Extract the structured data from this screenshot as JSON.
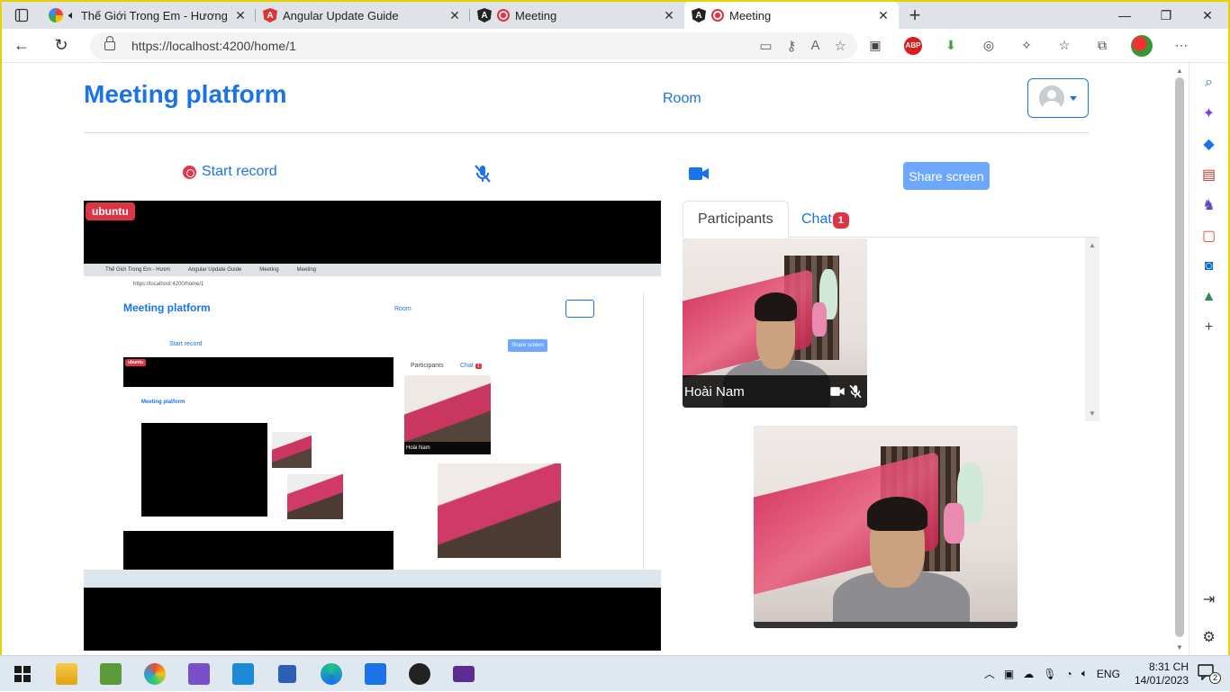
{
  "browser": {
    "tabs": [
      {
        "title": "Thế Giới Trong Em - Hương",
        "active": false
      },
      {
        "title": "Angular Update Guide",
        "active": false
      },
      {
        "title": "Meeting",
        "active": false
      },
      {
        "title": "Meeting",
        "active": true
      }
    ],
    "url": "https://localhost:4200/home/1"
  },
  "app": {
    "brand": "Meeting platform",
    "nav_room": "Room",
    "controls": {
      "start_record": "Start record",
      "share_screen": "Share screen",
      "mic_state": "muted",
      "camera_state": "on"
    },
    "main_video": {
      "badge": "ubuntu",
      "shared_screen": {
        "tabs": [
          "Thế Giới Trong Em - Hươn",
          "Angular Update Guide",
          "Meeting",
          "Meeting"
        ],
        "url": "https://localhost:4200/home/1",
        "brand": "Meeting platform",
        "room": "Room",
        "start_record": "Start record",
        "share_screen": "Share screen",
        "participants_tab": "Participants",
        "chat_tab": "Chat",
        "chat_count": "1",
        "badge": "ubuntu",
        "participant_name": "Hoài Nam"
      }
    },
    "side_tabs": {
      "participants": "Participants",
      "chat": "Chat",
      "chat_badge": "1"
    },
    "participants": [
      {
        "name": "Hoài Nam",
        "camera": "on",
        "mic": "muted"
      }
    ]
  },
  "taskbar": {
    "language": "ENG",
    "time": "8:31 CH",
    "date": "14/01/2023",
    "notifications": "2"
  },
  "colors": {
    "accent": "#1a73e8",
    "danger": "#dc3545",
    "share_button": "#6ea8fe"
  }
}
